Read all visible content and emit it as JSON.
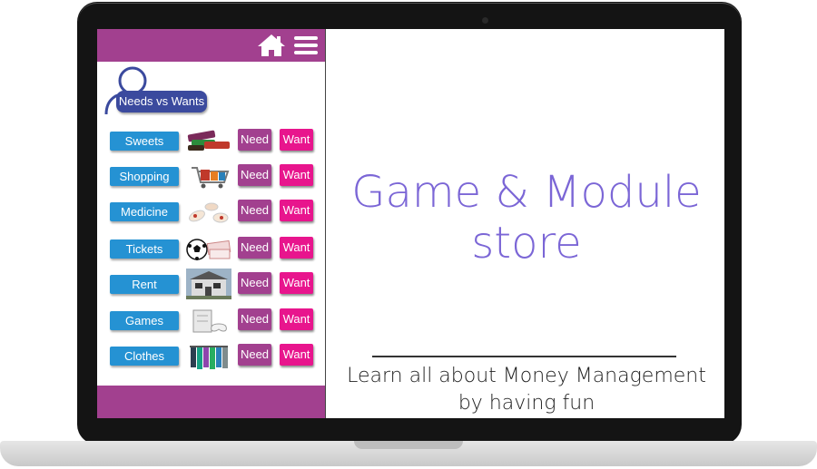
{
  "app": {
    "header_title": "Needs vs Wants",
    "icons": {
      "home": "home-icon",
      "menu": "hamburger-menu-icon",
      "profile": "person-icon"
    },
    "colors": {
      "topbar": "#a2408f",
      "item_button": "#2592d3",
      "need_button": "#a2408f",
      "want_button": "#e8158d"
    },
    "items": [
      {
        "label": "Sweets",
        "need": "Need",
        "want": "Want",
        "image": "sweets-image"
      },
      {
        "label": "Shopping",
        "need": "Need",
        "want": "Want",
        "image": "shopping-cart-image"
      },
      {
        "label": "Medicine",
        "need": "Need",
        "want": "Want",
        "image": "medicine-pills-image"
      },
      {
        "label": "Tickets",
        "need": "Need",
        "want": "Want",
        "image": "football-tickets-image"
      },
      {
        "label": "Rent",
        "need": "Need",
        "want": "Want",
        "image": "house-image"
      },
      {
        "label": "Games",
        "need": "Need",
        "want": "Want",
        "image": "game-console-image"
      },
      {
        "label": "Clothes",
        "need": "Need",
        "want": "Want",
        "image": "clothes-rack-image"
      }
    ]
  },
  "promo": {
    "title_line1": "Game & Module",
    "title_line2": "store",
    "tagline_line1": "Learn all about Money Management",
    "tagline_line2": "by having fun",
    "title_color": "#7b66d6"
  }
}
